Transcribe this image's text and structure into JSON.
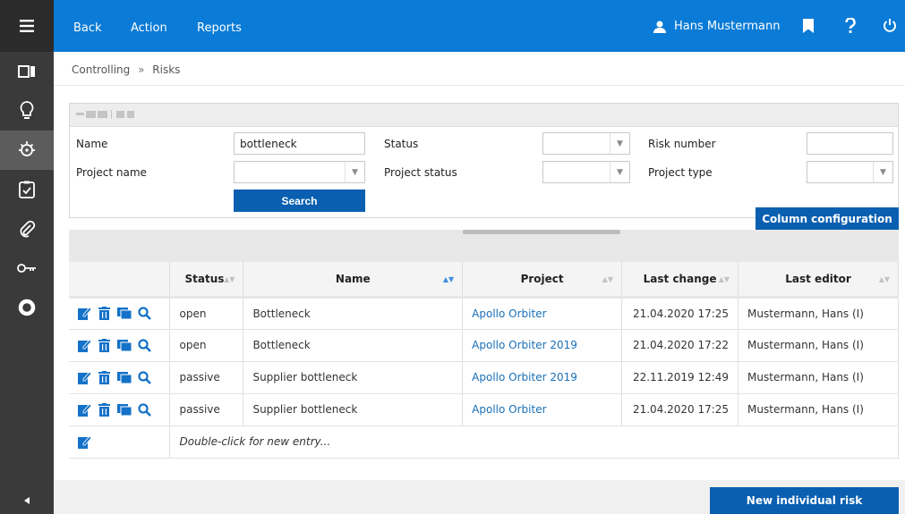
{
  "header": {
    "nav": [
      "Back",
      "Action",
      "Reports"
    ],
    "user_name": "Hans Mustermann"
  },
  "breadcrumb": {
    "items": [
      "Controlling",
      "Risks"
    ],
    "separator": "»"
  },
  "filter": {
    "fields": {
      "name": {
        "label": "Name",
        "value": "bottleneck"
      },
      "status": {
        "label": "Status",
        "value": ""
      },
      "risk_number": {
        "label": "Risk number",
        "value": ""
      },
      "project_name": {
        "label": "Project name",
        "value": ""
      },
      "project_status": {
        "label": "Project status",
        "value": ""
      },
      "project_type": {
        "label": "Project type",
        "value": ""
      }
    },
    "search_label": "Search",
    "column_config_label": "Column configuration"
  },
  "table": {
    "columns": [
      "Status",
      "Name",
      "Project",
      "Last change",
      "Last editor"
    ],
    "rows": [
      {
        "status": "open",
        "name": "Bottleneck",
        "project": "Apollo Orbiter",
        "last_change": "21.04.2020 17:25",
        "last_editor": "Mustermann, Hans (I)"
      },
      {
        "status": "open",
        "name": "Bottleneck",
        "project": "Apollo Orbiter 2019",
        "last_change": "21.04.2020 17:22",
        "last_editor": "Mustermann, Hans (I)"
      },
      {
        "status": "passive",
        "name": "Supplier bottleneck",
        "project": "Apollo Orbiter 2019",
        "last_change": "22.11.2019 12:49",
        "last_editor": "Mustermann, Hans (I)"
      },
      {
        "status": "passive",
        "name": "Supplier bottleneck",
        "project": "Apollo Orbiter",
        "last_change": "21.04.2020 17:25",
        "last_editor": "Mustermann, Hans (I)"
      }
    ],
    "new_entry_hint": "Double-click for new entry..."
  },
  "footer": {
    "new_risk_label": "New individual risk"
  },
  "sidebar": {
    "icons": [
      "menu-icon",
      "tiles-icon",
      "lightbulb-icon",
      "risk-icon",
      "checklist-icon",
      "paperclip-icon",
      "key-icon",
      "lifebuoy-icon",
      "collapse-arrow-icon"
    ]
  },
  "colors": {
    "header_blue": "#0a7bd6",
    "button_blue": "#0a5fb0",
    "sidebar_dark": "#3a3a3a",
    "link_blue": "#1a6fb8"
  }
}
